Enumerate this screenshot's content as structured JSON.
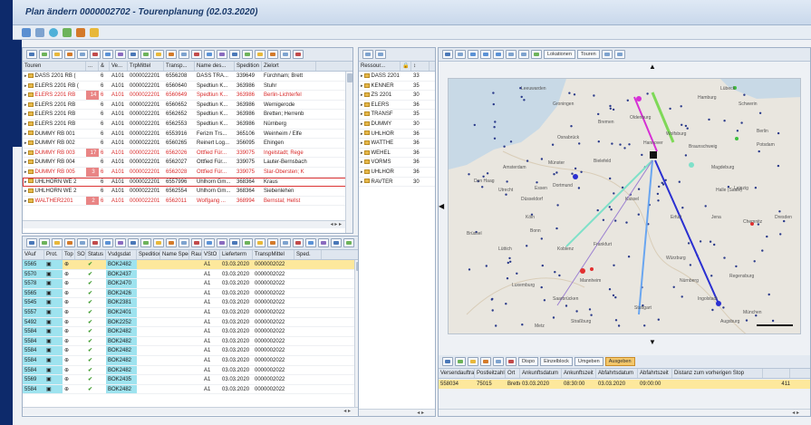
{
  "window": {
    "title": "Plan ändern 0000002702 - Tourenplanung (02.03.2020)"
  },
  "tours": {
    "columns": [
      "Touren",
      "...",
      "&",
      "Ve...",
      "TrpMittel",
      "Transp...",
      "Name des...",
      "Spedition",
      "Zielort"
    ],
    "rows": [
      {
        "name": "DASS 2201 RB (",
        "flag": "",
        "n": "6",
        "v": "A101",
        "tm": "0000022201",
        "tp": "6556208",
        "nm": "DASS TRA...",
        "sp": "339649",
        "z": "Fürchham; Brett",
        "style": "normal"
      },
      {
        "name": "ELERS 2201 RB (",
        "flag": "",
        "n": "6",
        "v": "A101",
        "tm": "0000022201",
        "tp": "6560640",
        "nm": "Spedtiun K...",
        "sp": "363986",
        "z": "Stuhr",
        "style": "normal"
      },
      {
        "name": "ELERS 2201 RB",
        "flag": "14",
        "n": "6",
        "v": "A101",
        "tm": "0000022201",
        "tp": "6560649",
        "nm": "Spedtiun K...",
        "sp": "363986",
        "z": "Berlin-Lichterfel",
        "style": "red"
      },
      {
        "name": "ELERS 2201 RB",
        "flag": "",
        "n": "6",
        "v": "A101",
        "tm": "0000022201",
        "tp": "6560652",
        "nm": "Spedtiun K...",
        "sp": "363986",
        "z": "Wernigerode",
        "style": "normal"
      },
      {
        "name": "ELERS 2201 RB",
        "flag": "",
        "n": "6",
        "v": "A101",
        "tm": "0000022201",
        "tp": "6562652",
        "nm": "Spedtiun K...",
        "sp": "363986",
        "z": "Bretten; Herrenb",
        "style": "normal"
      },
      {
        "name": "ELERS 2201 RB",
        "flag": "",
        "n": "6",
        "v": "A101",
        "tm": "0000022201",
        "tp": "6562553",
        "nm": "Spedtiun K...",
        "sp": "363986",
        "z": "Nürnberg",
        "style": "normal"
      },
      {
        "name": "DUMMY RB 001",
        "flag": "",
        "n": "6",
        "v": "A101",
        "tm": "0000022201",
        "tp": "6553916",
        "nm": "Ferizm Trs...",
        "sp": "365106",
        "z": "Weinheim / Elfe",
        "style": "normal"
      },
      {
        "name": "DUMMY RB 002",
        "flag": "",
        "n": "6",
        "v": "A101",
        "tm": "0000022201",
        "tp": "6560265",
        "nm": "Reinert Log...",
        "sp": "356095",
        "z": "Ehingen",
        "style": "normal"
      },
      {
        "name": "DUMMY RB 003",
        "flag": "17",
        "n": "6",
        "v": "A101",
        "tm": "0000022201",
        "tp": "6562026",
        "nm": "Ottfied Für...",
        "sp": "339075",
        "z": "Ingelstadt; Rege",
        "style": "red"
      },
      {
        "name": "DUMMY RB 004",
        "flag": "",
        "n": "6",
        "v": "A101",
        "tm": "0000022201",
        "tp": "6562027",
        "nm": "Ottfied Für...",
        "sp": "339075",
        "z": "Lauter-Bernsbach",
        "style": "normal"
      },
      {
        "name": "DUMMY RB 005",
        "flag": "3",
        "n": "6",
        "v": "A101",
        "tm": "0000022201",
        "tp": "6562028",
        "nm": "Ottfied Für...",
        "sp": "339075",
        "z": "Slar-Obersten; K",
        "style": "red"
      },
      {
        "name": "UHLHORN WE 2",
        "flag": "",
        "n": "6",
        "v": "A101",
        "tm": "0000022201",
        "tp": "6557996",
        "nm": "Uhlhorn Gm...",
        "sp": "368364",
        "z": "Kraus",
        "style": "selected"
      },
      {
        "name": "UHLHORN WE 2",
        "flag": "",
        "n": "6",
        "v": "A101",
        "tm": "0000022201",
        "tp": "6562554",
        "nm": "Uhlhorn Gm...",
        "sp": "368364",
        "z": "Siebenlehen",
        "style": "normal"
      },
      {
        "name": "WALTHER2201",
        "flag": "2",
        "n": "6",
        "v": "A101",
        "tm": "0000022201",
        "tp": "6562011",
        "nm": "Wolfgang ...",
        "sp": "368994",
        "z": "Bernstal; Hellst",
        "style": "red"
      }
    ]
  },
  "deliveries": {
    "columns": [
      "VAuf",
      "Prot.",
      "Top",
      "SO",
      "Status",
      "Vsdgsdat",
      "Spedition",
      "Name Spedit",
      "Rau",
      "VStO",
      "Lieferterm",
      "TranspMittel",
      "Sped."
    ],
    "rows": [
      {
        "id": "5565",
        "sd": "BOK2482",
        "vs": "A1",
        "dt": "03.03.2020",
        "tm": "0000002022"
      },
      {
        "id": "5570",
        "sd": "BOK2437",
        "vs": "A1",
        "dt": "03.03.2020",
        "tm": "0000002022"
      },
      {
        "id": "5578",
        "sd": "BOK2470",
        "vs": "A1",
        "dt": "03.03.2020",
        "tm": "0000002022"
      },
      {
        "id": "5565",
        "sd": "BOK2426",
        "vs": "A1",
        "dt": "03.03.2020",
        "tm": "0000002022"
      },
      {
        "id": "5545",
        "sd": "BOK2381",
        "vs": "A1",
        "dt": "03.03.2020",
        "tm": "0000002022"
      },
      {
        "id": "5557",
        "sd": "BOK2401",
        "vs": "A1",
        "dt": "03.03.2020",
        "tm": "0000002022"
      },
      {
        "id": "5492",
        "sd": "BOK2252",
        "vs": "A1",
        "dt": "03.03.2020",
        "tm": "0000002022"
      },
      {
        "id": "5584",
        "sd": "BOK2482",
        "vs": "A1",
        "dt": "03.03.2020",
        "tm": "0000002022"
      },
      {
        "id": "5584",
        "sd": "BOK2482",
        "vs": "A1",
        "dt": "03.03.2020",
        "tm": "0000002022"
      },
      {
        "id": "5584",
        "sd": "BOK2482",
        "vs": "A1",
        "dt": "03.03.2020",
        "tm": "0000002022"
      },
      {
        "id": "5584",
        "sd": "BOK2482",
        "vs": "A1",
        "dt": "03.03.2020",
        "tm": "0000002022"
      },
      {
        "id": "5584",
        "sd": "BOK2482",
        "vs": "A1",
        "dt": "03.03.2020",
        "tm": "0000002022"
      },
      {
        "id": "5569",
        "sd": "BOK2435",
        "vs": "A1",
        "dt": "03.03.2020",
        "tm": "0000002022"
      },
      {
        "id": "5584",
        "sd": "BOK2482",
        "vs": "A1",
        "dt": "03.03.2020",
        "tm": "0000002022"
      }
    ]
  },
  "resources": {
    "columns": [
      "Ressour...",
      "",
      ""
    ],
    "rows": [
      {
        "name": "DASS 2201",
        "num": "33"
      },
      {
        "name": "KENNER",
        "num": "35"
      },
      {
        "name": "ZS 2201",
        "num": "30"
      },
      {
        "name": "ELERS",
        "num": "36"
      },
      {
        "name": "TRANSF",
        "num": "35"
      },
      {
        "name": "DUMMY",
        "num": "30"
      },
      {
        "name": "UHLHOR",
        "num": "36"
      },
      {
        "name": "WATTHE",
        "num": "36"
      },
      {
        "name": "WEHEL",
        "num": "36"
      },
      {
        "name": "VORMS",
        "num": "36"
      },
      {
        "name": "UHLHOR",
        "num": "36"
      },
      {
        "name": "RAVTER",
        "num": "30"
      }
    ]
  },
  "map": {
    "toolbar": {
      "locations_label": "Lokationen",
      "tours_label": "Touren"
    },
    "cities": [
      "Leeuwarden",
      "Groningen",
      "Oldenburg",
      "Bremen",
      "Hamburg",
      "Schwerin",
      "Lübeck",
      "Amsterdam",
      "Den Haag",
      "Utrecht",
      "Osnabrück",
      "Hannover",
      "Braunschweig",
      "Magdeburg",
      "Berlin",
      "Wolfsburg",
      "Potsdam",
      "Münster",
      "Bielefeld",
      "Dortmund",
      "Essen",
      "Düsseldorf",
      "Kassel",
      "Halle (Saale)",
      "Leipzig",
      "Dresden",
      "Chemnitz",
      "Brüssel",
      "Köln",
      "Bonn",
      "Erfurt",
      "Jena",
      "Lüttich",
      "Koblenz",
      "Frankfurt",
      "Würzburg",
      "Nürnberg",
      "Regensburg",
      "Luxemburg",
      "Mannheim",
      "Saarbrücken",
      "Stuttgart",
      "Straßburg",
      "Ingolstadt",
      "München",
      "Augsburg",
      "Metz"
    ]
  },
  "bottom": {
    "buttons": [
      "Dispo",
      "Einzelblock",
      "Umgeben",
      "Ausgeben"
    ],
    "columns": [
      "Versendauftrag",
      "Postleitzahl",
      "Ort",
      "Ankunftsdatum",
      "Ankunftszeit",
      "Abfahrtsdatum",
      "Abfahrtszeit",
      "Distanz zum vorherigen Stop",
      ""
    ],
    "row": {
      "order": "558034",
      "plz": "75015",
      "ort": "Bretten",
      "adate": "03.03.2020",
      "atime": "08:30:00",
      "ddate": "03.03.2020",
      "dtime": "09:00:00",
      "dist": "",
      "n": "411"
    }
  },
  "colors": {
    "accent": "#1a3a6b",
    "highlight": "#fde89c",
    "cyan": "#9ee3ef",
    "red": "#e98585"
  }
}
